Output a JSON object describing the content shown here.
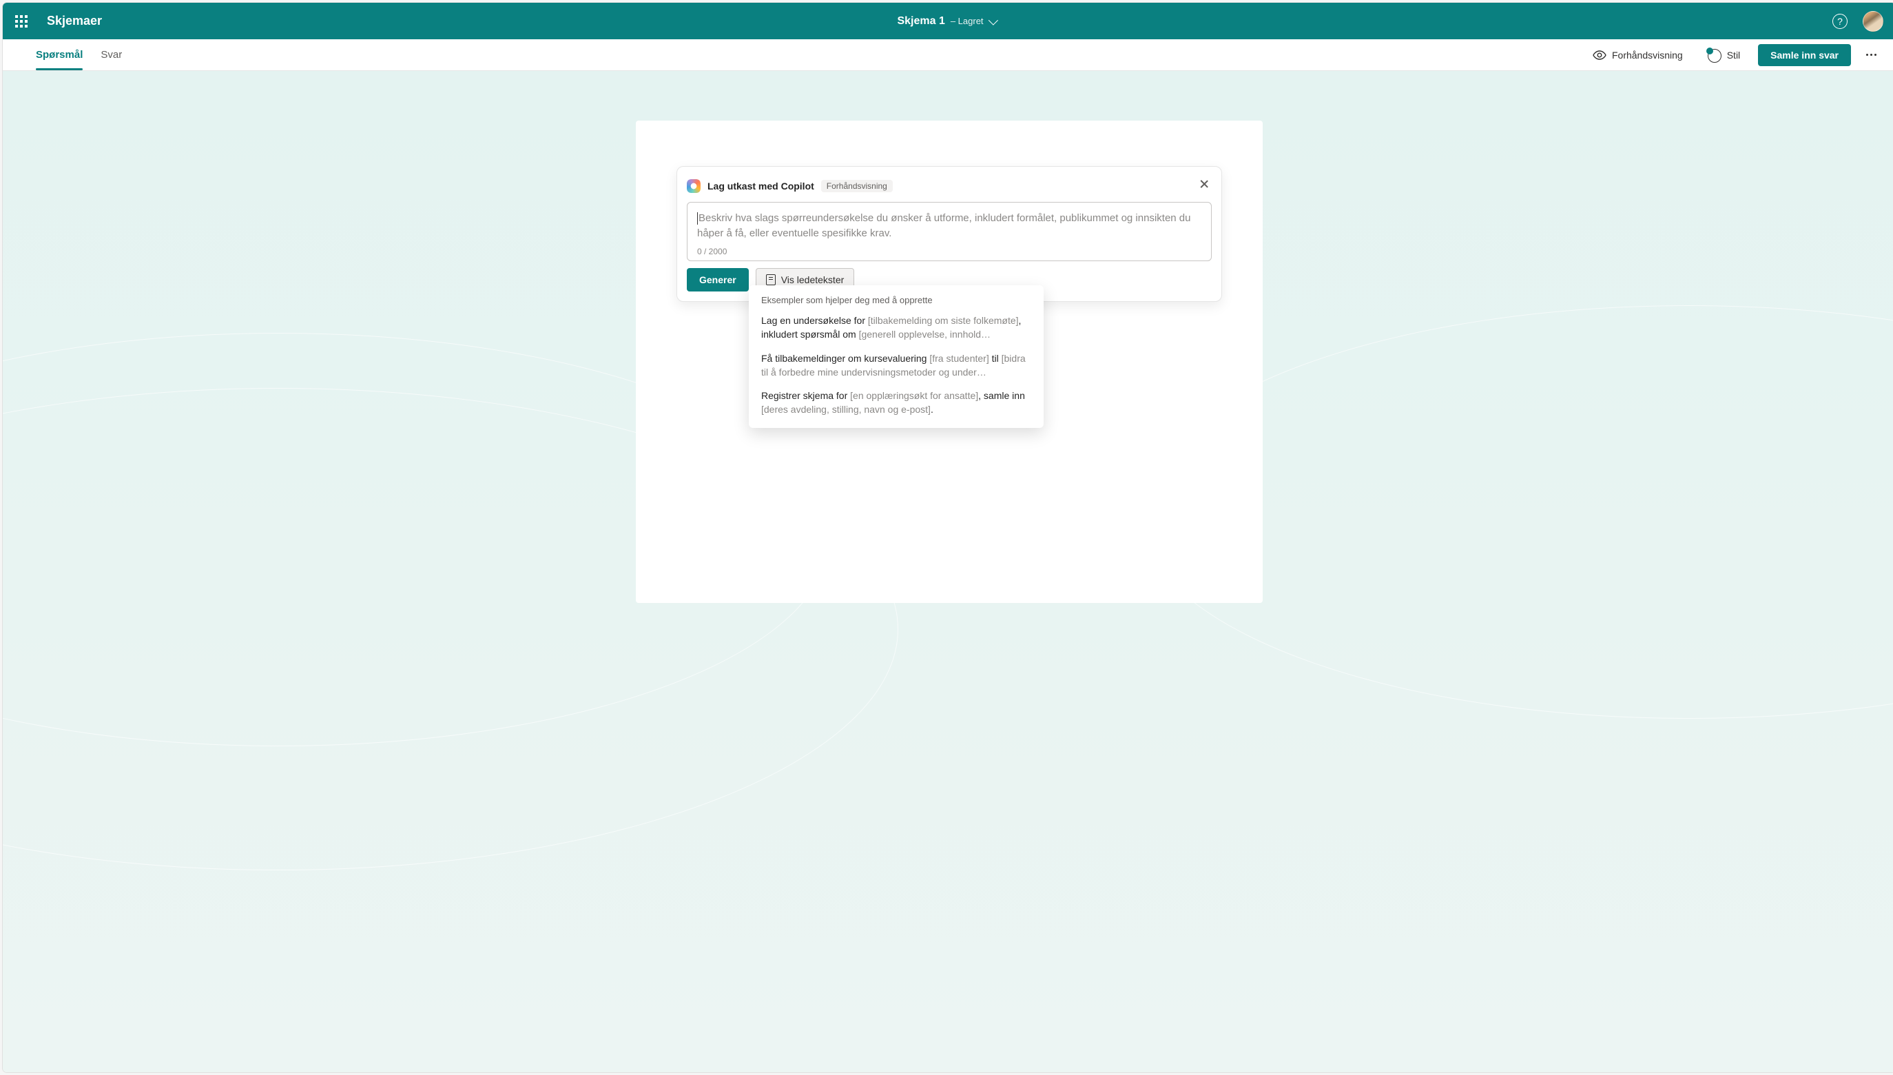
{
  "header": {
    "app_name": "Skjemaer",
    "form_title": "Skjema 1",
    "form_status": "– Lagret"
  },
  "tabs": {
    "questions": "Spørsmål",
    "responses": "Svar"
  },
  "toolbar": {
    "preview": "Forhåndsvisning",
    "style": "Stil",
    "collect": "Samle inn svar"
  },
  "copilot": {
    "title": "Lag utkast med Copilot",
    "badge": "Forhåndsvisning",
    "placeholder": "Beskriv hva slags spørreundersøkelse du ønsker å utforme, inkludert formålet, publikummet og innsikten du håper å få, eller eventuelle spesifikke krav.",
    "char_count": "0 / 2000",
    "generate": "Generer",
    "show_prompts": "Vis ledetekster"
  },
  "dropdown": {
    "header": "Eksempler som hjelper deg med å opprette",
    "items": [
      {
        "b1": "Lag en undersøkelse for ",
        "g1": "[tilbakemelding om siste folkemøte]",
        "b2": ", inkludert spørsmål om ",
        "g2": "[generell opplevelse, innhold…"
      },
      {
        "b1": "Få tilbakemeldinger om kursevaluering ",
        "g1": "[fra studenter]",
        "b2": " til ",
        "g2": "[bidra til å forbedre mine undervisningsmetoder og under…"
      },
      {
        "b1": "Registrer skjema for ",
        "g1": "[en opplæringsøkt for ansatte]",
        "b2": ", samle inn ",
        "g2": "[deres avdeling, stilling, navn og e-post]",
        "b3": "."
      }
    ]
  }
}
